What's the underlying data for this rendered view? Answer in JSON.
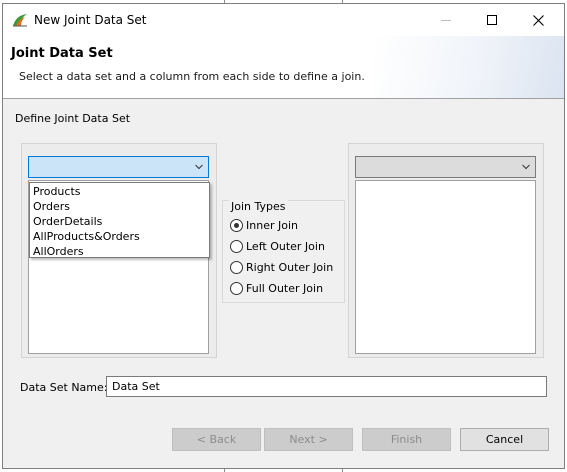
{
  "window": {
    "title": "New Joint Data Set"
  },
  "header": {
    "title": "Joint Data Set",
    "description": "Select a data set and a column from each side to define a join."
  },
  "define": {
    "label": "Define Joint Data Set"
  },
  "left_dataset": {
    "selected": "",
    "options": [
      "Products",
      "Orders",
      "OrderDetails",
      "AllProducts&Orders",
      "AllOrders"
    ]
  },
  "right_dataset": {
    "selected": ""
  },
  "join_types": {
    "legend": "Join Types",
    "options": [
      {
        "label": "Inner Join",
        "checked": true
      },
      {
        "label": "Left Outer Join",
        "checked": false
      },
      {
        "label": "Right Outer Join",
        "checked": false
      },
      {
        "label": "Full Outer Join",
        "checked": false
      }
    ]
  },
  "name_field": {
    "label": "Data Set Name:",
    "value": "Data Set"
  },
  "buttons": {
    "back": "< Back",
    "next": "Next >",
    "finish": "Finish",
    "cancel": "Cancel"
  },
  "colors": {
    "focus_border": "#0078d7",
    "focus_fill": "#cce4f7",
    "dialog_bg": "#f0f0f0"
  },
  "icons": {
    "app": "birt-app-icon",
    "minimize": "minimize-icon",
    "maximize": "maximize-icon",
    "close": "close-icon",
    "dropdown": "chevron-down-icon"
  }
}
